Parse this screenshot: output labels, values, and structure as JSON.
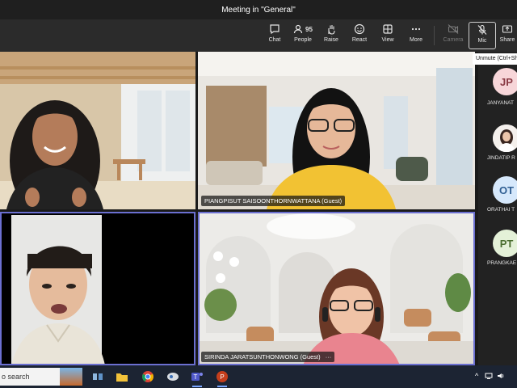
{
  "window": {
    "title": "Meeting in \"General\""
  },
  "toolbar": {
    "chat": "Chat",
    "people": "People",
    "people_count": "95",
    "raise": "Raise",
    "react": "React",
    "view": "View",
    "more": "More",
    "camera": "Camera",
    "mic": "Mic",
    "share": "Share"
  },
  "tooltip": "Unmute (Ctrl+Shift+M)",
  "tiles": {
    "t1_name": "",
    "t2_name": "PIANGPISUT SAISOONTHORNWATTANA (Guest)",
    "t3_name": "",
    "t4_name": "SIRINDA JARATSUNTHONWONG (Guest)"
  },
  "roster": [
    {
      "initials": "JP",
      "name": "JANYANAT",
      "color": "#f7d6d9",
      "text": "#8a3b45"
    },
    {
      "initials": "",
      "name": "JINDATIP R",
      "color": "#ffffff",
      "text": "#333"
    },
    {
      "initials": "OT",
      "name": "ORATHAI T",
      "color": "#d6e8fb",
      "text": "#2f5e92"
    },
    {
      "initials": "PT",
      "name": "PRANGKAE",
      "color": "#e4f1d8",
      "text": "#4a6e2f"
    }
  ],
  "taskbar": {
    "search": "o search"
  }
}
